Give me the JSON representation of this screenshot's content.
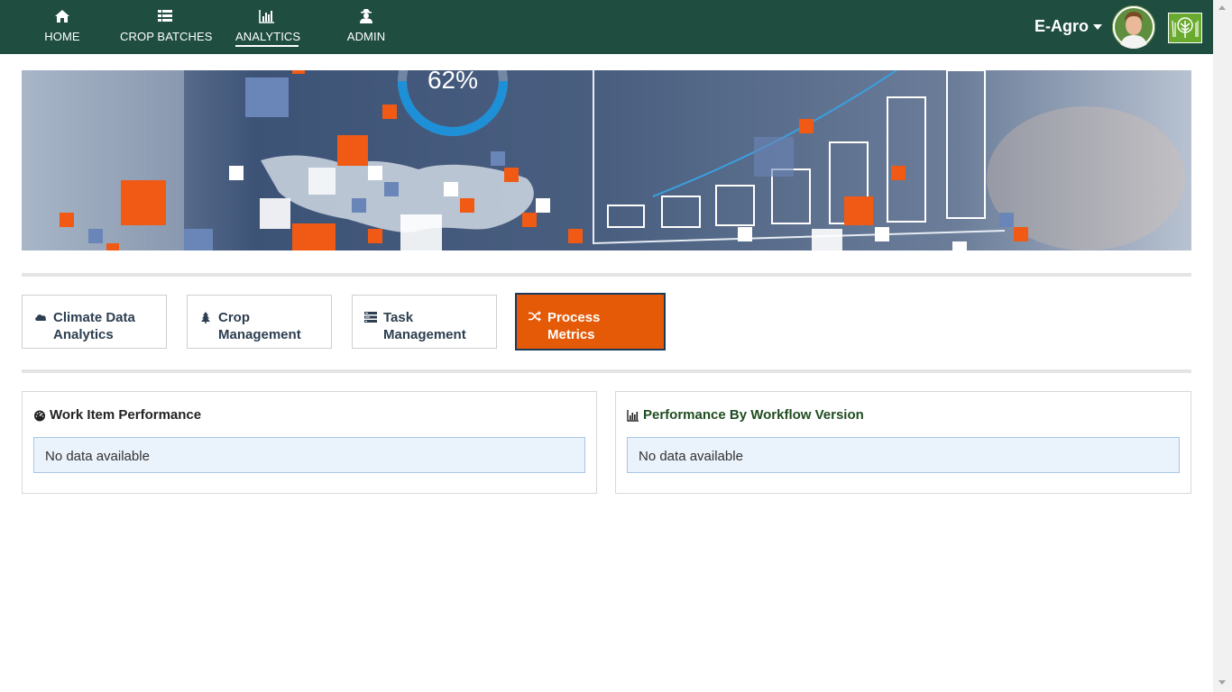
{
  "nav": {
    "items": [
      {
        "label": "HOME",
        "icon": "home-icon",
        "active": false
      },
      {
        "label": "CROP BATCHES",
        "icon": "list-icon",
        "active": false
      },
      {
        "label": "ANALYTICS",
        "icon": "bar-chart-icon",
        "active": true
      },
      {
        "label": "ADMIN",
        "icon": "user-secret-icon",
        "active": false
      }
    ],
    "user_menu_label": "E-Agro"
  },
  "banner": {
    "percent_label": "62%"
  },
  "tabs": [
    {
      "label_line1": "Climate Data",
      "label_line2": "Analytics",
      "icon": "cloud-icon",
      "active": false
    },
    {
      "label_line1": "Crop",
      "label_line2": "Management",
      "icon": "tree-icon",
      "active": false
    },
    {
      "label_line1": "Task",
      "label_line2": "Management",
      "icon": "tasks-icon",
      "active": false
    },
    {
      "label_line1": "Process",
      "label_line2": "Metrics",
      "icon": "shuffle-icon",
      "active": true
    }
  ],
  "panels": [
    {
      "title": "Work Item Performance",
      "icon": "dashboard-icon",
      "message": "No data available"
    },
    {
      "title": "Performance By Workflow Version",
      "icon": "bar-chart-icon",
      "message": "No data available"
    }
  ],
  "colors": {
    "navbar": "#1f4d40",
    "accent": "#e55a07",
    "panel_alert_bg": "#eaf2fb"
  }
}
